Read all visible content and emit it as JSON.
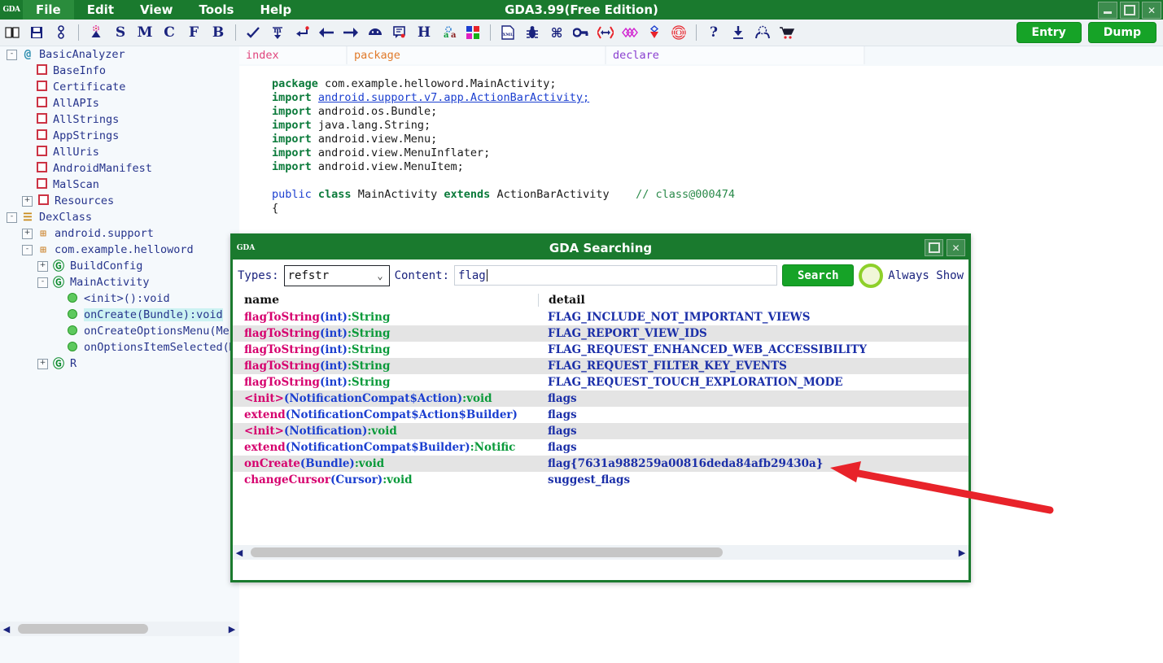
{
  "window": {
    "title": "GDA3.99(Free Edition)",
    "logo": "GDA",
    "controls": [
      {
        "name": "minimize-button",
        "glyph": "min"
      },
      {
        "name": "maximize-button",
        "glyph": "max"
      },
      {
        "name": "close-button",
        "glyph": "✕"
      }
    ]
  },
  "menubar": {
    "items": [
      {
        "label": "File",
        "active": true
      },
      {
        "label": "Edit",
        "active": false
      },
      {
        "label": "View",
        "active": false
      },
      {
        "label": "Tools",
        "active": false
      },
      {
        "label": "Help",
        "active": false
      }
    ]
  },
  "toolbar": {
    "icons": [
      {
        "name": "book-icon",
        "glyph": "☐"
      },
      {
        "name": "save-icon",
        "glyph": "ὋE"
      },
      {
        "name": "link-icon",
        "glyph": "⚭"
      },
      {
        "name": "separator",
        "glyph": "|"
      },
      {
        "name": "antenna-icon",
        "glyph": "▲"
      },
      {
        "name": "string-icon",
        "glyph": "S"
      },
      {
        "name": "method-icon",
        "glyph": "M"
      },
      {
        "name": "class-icon",
        "glyph": "C"
      },
      {
        "name": "field-icon",
        "glyph": "F"
      },
      {
        "name": "bytecode-icon",
        "glyph": "B"
      },
      {
        "name": "separator",
        "glyph": "|"
      },
      {
        "name": "check-icon",
        "glyph": "✔"
      },
      {
        "name": "download-m-icon",
        "glyph": "ᵐ"
      },
      {
        "name": "return-icon",
        "glyph": "↵"
      },
      {
        "name": "back-arrow-icon",
        "glyph": "←"
      },
      {
        "name": "forward-arrow-icon",
        "glyph": "→"
      },
      {
        "name": "android-icon",
        "glyph": "◑"
      },
      {
        "name": "comment-icon",
        "glyph": "Ὓ9"
      },
      {
        "name": "hex-icon",
        "glyph": "H"
      },
      {
        "name": "rename-icon",
        "glyph": "aa"
      },
      {
        "name": "palette-icon",
        "glyph": "■"
      },
      {
        "name": "separator",
        "glyph": "|"
      },
      {
        "name": "xml-icon",
        "glyph": "XML"
      },
      {
        "name": "bug-icon",
        "glyph": "ὁB"
      },
      {
        "name": "command-icon",
        "glyph": "⌘"
      },
      {
        "name": "key-icon",
        "glyph": "⚷"
      },
      {
        "name": "compare-icon",
        "glyph": "⬌"
      },
      {
        "name": "network-icon",
        "glyph": "⁂"
      },
      {
        "name": "signature-icon",
        "glyph": "◇"
      },
      {
        "name": "fingerprint-icon",
        "glyph": "◎"
      },
      {
        "name": "separator",
        "glyph": "|"
      },
      {
        "name": "help-icon",
        "glyph": "?"
      },
      {
        "name": "download-icon",
        "glyph": "⬇"
      },
      {
        "name": "emulator-icon",
        "glyph": "⚙"
      },
      {
        "name": "cart-icon",
        "glyph": "Ὥ2"
      }
    ],
    "entry_label": "Entry",
    "dump_label": "Dump"
  },
  "tree": {
    "items": [
      {
        "label": "BasicAnalyzer",
        "depth": 0,
        "expander": "-",
        "icon": "at",
        "selected": false
      },
      {
        "label": "BaseInfo",
        "depth": 1,
        "expander": "",
        "icon": "red",
        "selected": false
      },
      {
        "label": "Certificate",
        "depth": 1,
        "expander": "",
        "icon": "red",
        "selected": false
      },
      {
        "label": "AllAPIs",
        "depth": 1,
        "expander": "",
        "icon": "red",
        "selected": false
      },
      {
        "label": "AllStrings",
        "depth": 1,
        "expander": "",
        "icon": "red",
        "selected": false
      },
      {
        "label": "AppStrings",
        "depth": 1,
        "expander": "",
        "icon": "red",
        "selected": false
      },
      {
        "label": "AllUris",
        "depth": 1,
        "expander": "",
        "icon": "red",
        "selected": false
      },
      {
        "label": "AndroidManifest",
        "depth": 1,
        "expander": "",
        "icon": "red",
        "selected": false
      },
      {
        "label": "MalScan",
        "depth": 1,
        "expander": "",
        "icon": "red",
        "selected": false
      },
      {
        "label": "Resources",
        "depth": 1,
        "expander": "+",
        "icon": "red",
        "selected": false
      },
      {
        "label": "DexClass",
        "depth": 0,
        "expander": "-",
        "icon": "dex",
        "selected": false
      },
      {
        "label": "android.support",
        "depth": 1,
        "expander": "+",
        "icon": "pkg",
        "selected": false
      },
      {
        "label": "com.example.helloword",
        "depth": 1,
        "expander": "-",
        "icon": "pkg",
        "selected": false
      },
      {
        "label": "BuildConfig",
        "depth": 2,
        "expander": "+",
        "icon": "class",
        "selected": false
      },
      {
        "label": "MainActivity",
        "depth": 2,
        "expander": "-",
        "icon": "class",
        "selected": false
      },
      {
        "label": "<init>():void",
        "depth": 3,
        "expander": "",
        "icon": "method",
        "selected": false
      },
      {
        "label": "onCreate(Bundle):void",
        "depth": 3,
        "expander": "",
        "icon": "method",
        "selected": true
      },
      {
        "label": "onCreateOptionsMenu(Menu):boolean",
        "depth": 3,
        "expander": "",
        "icon": "method",
        "selected": false
      },
      {
        "label": "onOptionsItemSelected(MenuItem):boolean",
        "depth": 3,
        "expander": "",
        "icon": "method",
        "selected": false
      },
      {
        "label": "R",
        "depth": 2,
        "expander": "+",
        "icon": "class",
        "selected": false
      }
    ]
  },
  "editor": {
    "tabs": [
      {
        "label": "index",
        "name": "tab-index"
      },
      {
        "label": "package",
        "name": "tab-package"
      },
      {
        "label": "declare",
        "name": "tab-declare"
      }
    ],
    "code_lines": [
      "package com.example.helloword.MainActivity;",
      "import android.support.v7.app.ActionBarActivity;",
      "import android.os.Bundle;",
      "import java.lang.String;",
      "import android.view.Menu;",
      "import android.view.MenuInflater;",
      "import android.view.MenuItem;",
      "",
      "public class MainActivity extends ActionBarActivity    // class@000474",
      "{"
    ]
  },
  "dialog": {
    "title": "GDA Searching",
    "logo": "GDA",
    "controls": [
      {
        "name": "dialog-maximize-button",
        "glyph": "max"
      },
      {
        "name": "dialog-close-button",
        "glyph": "✕"
      }
    ],
    "types_label": "Types:",
    "types_value": "refstr",
    "content_label": "Content:",
    "content_value": "flag",
    "content_placeholder": "",
    "search_label": "Search",
    "always_show_label": "Always Show",
    "columns": [
      "name",
      "detail"
    ],
    "rows": [
      {
        "name": "flagToString(int):String",
        "detail": "FLAG_INCLUDE_NOT_IMPORTANT_VIEWS"
      },
      {
        "name": "flagToString(int):String",
        "detail": "FLAG_REPORT_VIEW_IDS"
      },
      {
        "name": "flagToString(int):String",
        "detail": "FLAG_REQUEST_ENHANCED_WEB_ACCESSIBILITY"
      },
      {
        "name": "flagToString(int):String",
        "detail": "FLAG_REQUEST_FILTER_KEY_EVENTS"
      },
      {
        "name": "flagToString(int):String",
        "detail": "FLAG_REQUEST_TOUCH_EXPLORATION_MODE"
      },
      {
        "name": "<init>(NotificationCompat$Action):void",
        "detail": "flags"
      },
      {
        "name": "extend(NotificationCompat$Action$Builder)",
        "detail": "flags"
      },
      {
        "name": "<init>(Notification):void",
        "detail": "flags"
      },
      {
        "name": "extend(NotificationCompat$Builder):Notific",
        "detail": "flags"
      },
      {
        "name": "onCreate(Bundle):void",
        "detail": "flag{7631a988259a00816deda84afb29430a}"
      },
      {
        "name": "changeCursor(Cursor):void",
        "detail": "suggest_flags"
      }
    ]
  },
  "colors": {
    "brand_green": "#1a7a2e",
    "button_green": "#16a327",
    "tree_blue": "#26348c",
    "name_pink": "#d6006e",
    "detail_blue": "#1b2fa8",
    "arrow_red": "#e8232a"
  }
}
